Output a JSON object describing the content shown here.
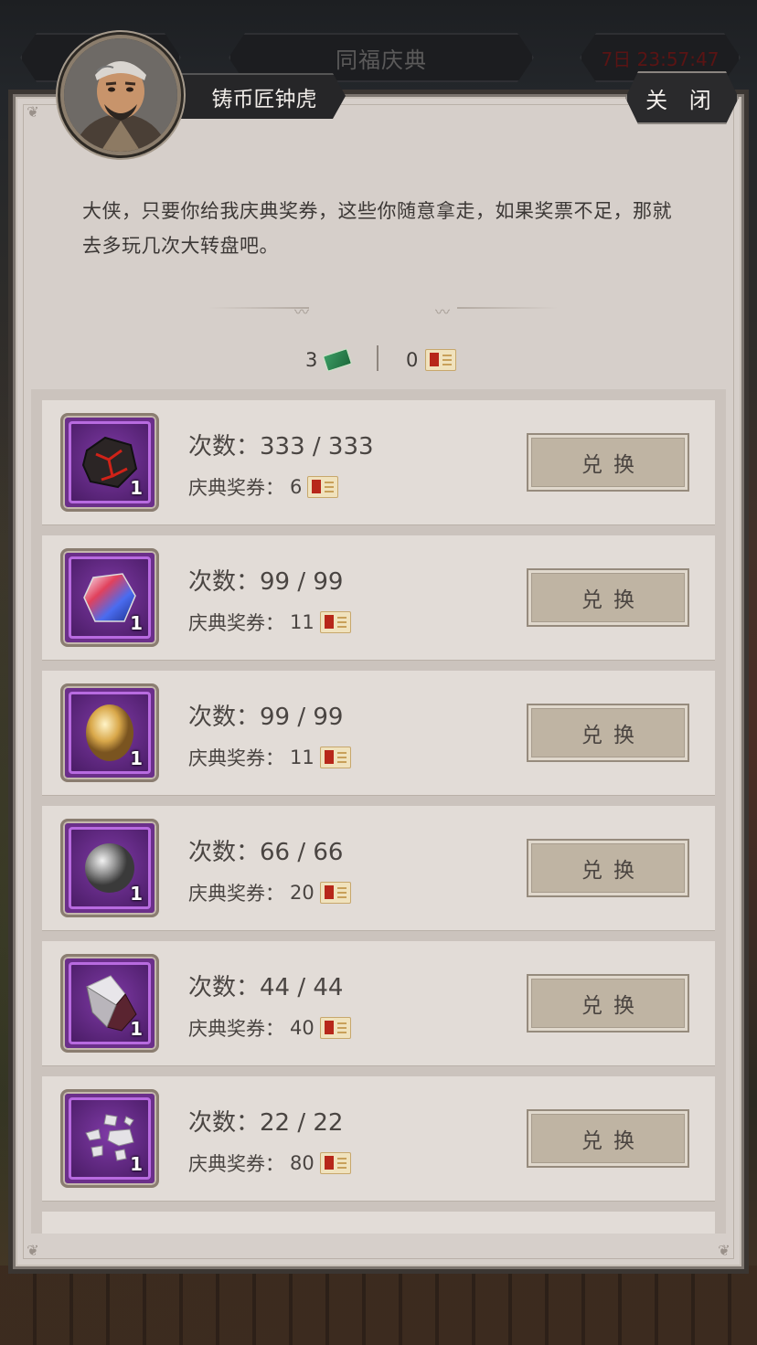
{
  "header": {
    "event_title": "同福庆典",
    "timer": "7日 23:57:47"
  },
  "npc": {
    "name": "铸币匠钟虎",
    "dialog": "大侠，只要你给我庆典奖券，这些你随意拿走，如果奖票不足，那就去多玩几次大转盘吧。"
  },
  "close_label": "关 闭",
  "currencies": [
    {
      "amount": "3",
      "icon": "jade-token-icon"
    },
    {
      "amount": "0",
      "icon": "celebration-ticket-icon"
    }
  ],
  "items": [
    {
      "name": "dark-ore",
      "qty": "1",
      "count": "次数：333 / 333",
      "price_label": "庆典奖券：",
      "price": "6",
      "button": "兑换"
    },
    {
      "name": "rainbow-crystal",
      "qty": "1",
      "count": "次数：99 / 99",
      "price_label": "庆典奖券：",
      "price": "11",
      "button": "兑换"
    },
    {
      "name": "golden-stone",
      "qty": "1",
      "count": "次数：99 / 99",
      "price_label": "庆典奖券：",
      "price": "11",
      "button": "兑换"
    },
    {
      "name": "iron-ball",
      "qty": "1",
      "count": "次数：66 / 66",
      "price_label": "庆典奖券：",
      "price": "20",
      "button": "兑换"
    },
    {
      "name": "red-crystal-ore",
      "qty": "1",
      "count": "次数：44 / 44",
      "price_label": "庆典奖券：",
      "price": "40",
      "button": "兑换"
    },
    {
      "name": "silver-fragments",
      "qty": "1",
      "count": "次数：22 / 22",
      "price_label": "庆典奖券：",
      "price": "80",
      "button": "兑换"
    }
  ],
  "colors": {
    "panel": "#d6cfca",
    "row": "#e2dcd7",
    "item_frame": "#6b2f8a",
    "button": "#bfb4a3"
  }
}
